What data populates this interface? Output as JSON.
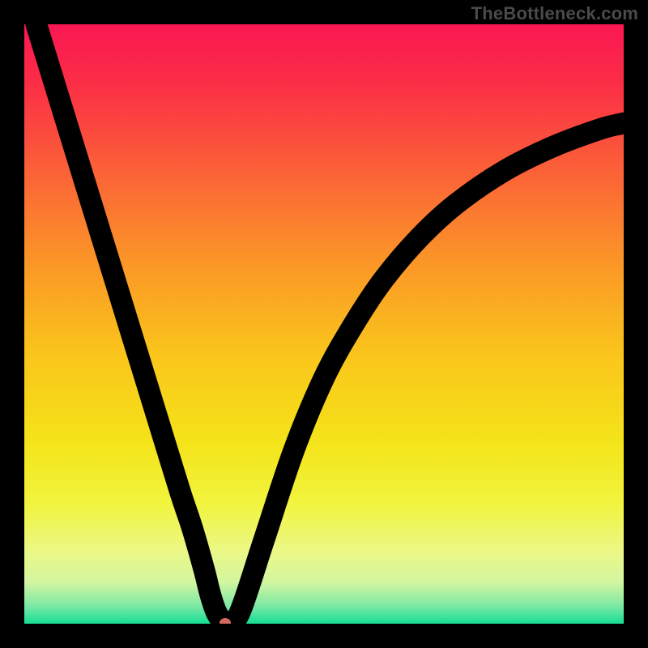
{
  "watermark": {
    "text": "TheBottleneck.com"
  },
  "chart_data": {
    "type": "line",
    "title": "",
    "xlabel": "",
    "ylabel": "",
    "xlim": [
      0,
      100
    ],
    "ylim": [
      0,
      100
    ],
    "grid": false,
    "legend": false,
    "background_gradient": {
      "direction": "vertical",
      "stops": [
        {
          "pos": 0.0,
          "color": "#fa1752"
        },
        {
          "pos": 0.1,
          "color": "#fb2e46"
        },
        {
          "pos": 0.25,
          "color": "#fb6337"
        },
        {
          "pos": 0.4,
          "color": "#fb9727"
        },
        {
          "pos": 0.55,
          "color": "#fac51b"
        },
        {
          "pos": 0.7,
          "color": "#f4e41a"
        },
        {
          "pos": 0.8,
          "color": "#f1f43e"
        },
        {
          "pos": 0.88,
          "color": "#ebf887"
        },
        {
          "pos": 0.93,
          "color": "#d4f6a0"
        },
        {
          "pos": 0.97,
          "color": "#7de9a4"
        },
        {
          "pos": 1.0,
          "color": "#15dd95"
        }
      ]
    },
    "series": [
      {
        "name": "bottleneck-curve",
        "x": [
          2,
          6,
          10,
          14,
          18,
          22,
          26,
          28,
          30,
          31,
          32,
          33,
          34,
          36,
          40,
          45,
          50,
          55,
          60,
          66,
          72,
          80,
          88,
          96,
          100
        ],
        "y": [
          100,
          87,
          74,
          61,
          48,
          35,
          22,
          16,
          9,
          5,
          2,
          0.5,
          0,
          2,
          14,
          29,
          41,
          50,
          57.5,
          64.5,
          70,
          75.5,
          79.5,
          82.5,
          83.5
        ]
      }
    ],
    "annotations": [
      {
        "name": "minimum-marker",
        "shape": "ellipse",
        "x": 33.5,
        "y": 0.2,
        "color": "#d06a5f"
      }
    ]
  }
}
